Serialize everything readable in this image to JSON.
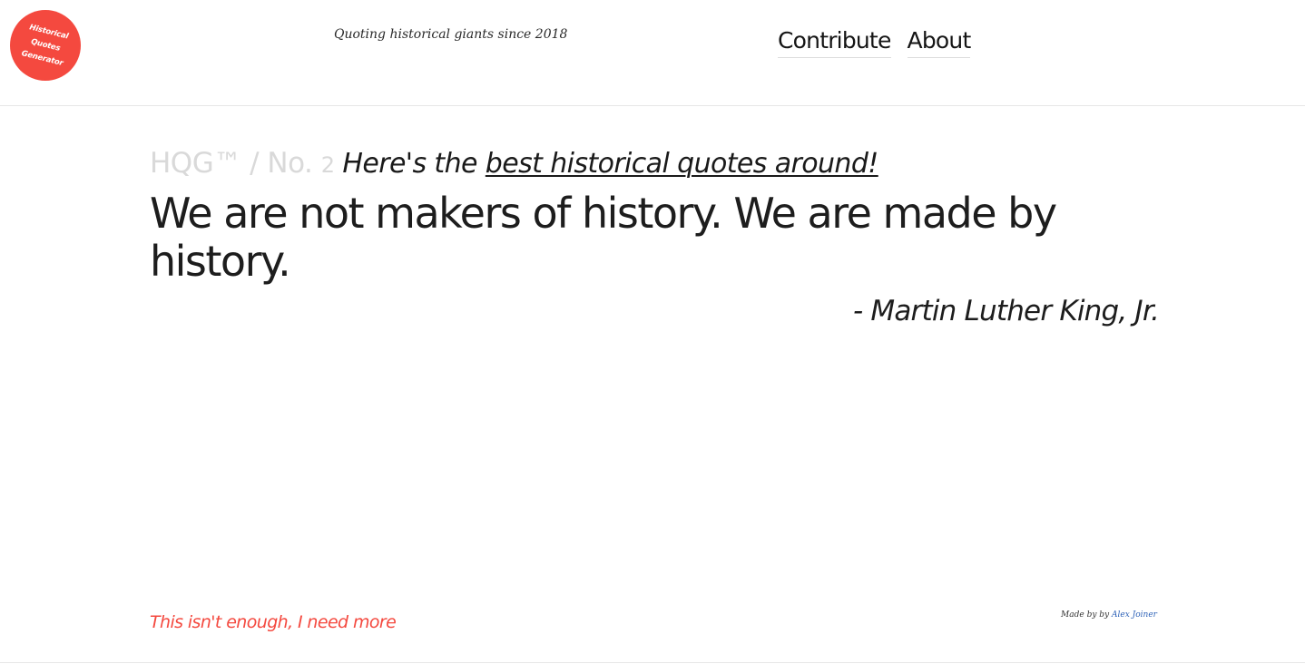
{
  "header": {
    "logo_text": "Historical Quotes Generator",
    "tagline": "Quoting historical giants since 2018",
    "nav": [
      {
        "label": "Contribute"
      },
      {
        "label": "About"
      }
    ]
  },
  "main": {
    "brand": "HQG™ / No.",
    "number": "2",
    "intro_prefix": "Here's the",
    "intro_link": "best historical quotes around!",
    "quote": "We are not makers of history. We are made by history.",
    "author": "- Martin Luther King, Jr."
  },
  "footer": {
    "more_link": "This isn't enough, I need more",
    "credit_prefix": "Made by by",
    "credit_link": "Alex Joiner"
  },
  "colors": {
    "accent": "#f4493f",
    "link": "#2f63b8",
    "brand_gray": "#d9d9d9",
    "text": "#1d1d1d"
  }
}
